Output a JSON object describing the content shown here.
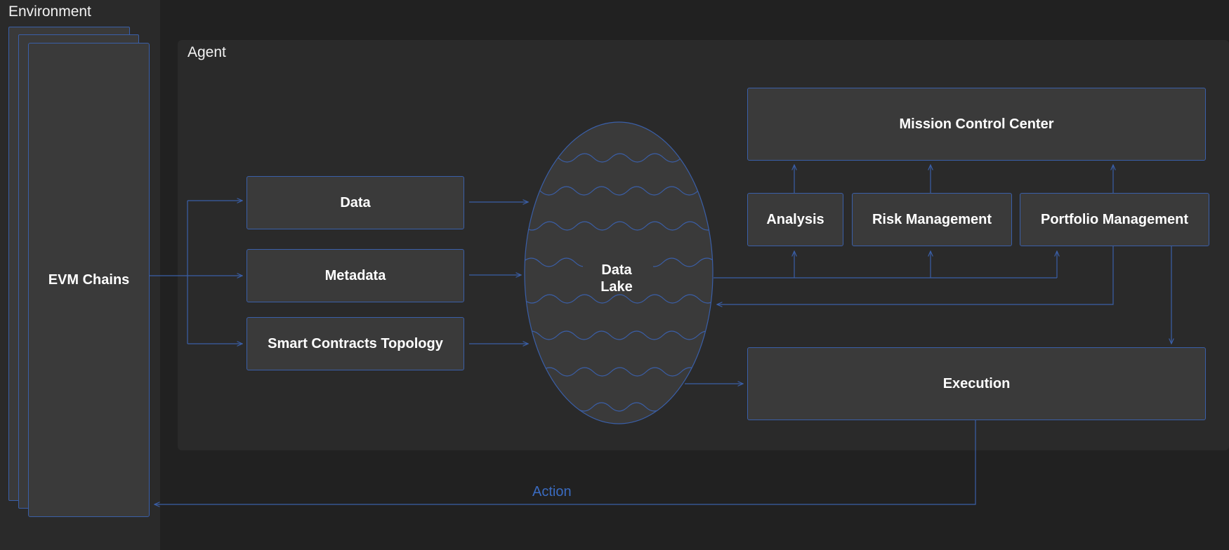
{
  "environment": {
    "title": "Environment",
    "source_label": "EVM Chains"
  },
  "agent": {
    "title": "Agent",
    "inputs": [
      "Data",
      "Metadata",
      "Smart Contracts Topology"
    ],
    "data_lake": {
      "line1": "Data",
      "line2": "Lake"
    },
    "mission_control": "Mission Control Center",
    "modules": [
      "Analysis",
      "Risk Management",
      "Portfolio Management"
    ],
    "execution": "Execution"
  },
  "action_label": "Action",
  "colors": {
    "background": "#212121",
    "panel": "#2a2a2a",
    "box": "#3a3a3a",
    "accent": "#3a5fa8",
    "action_text": "#3a6bc0"
  }
}
